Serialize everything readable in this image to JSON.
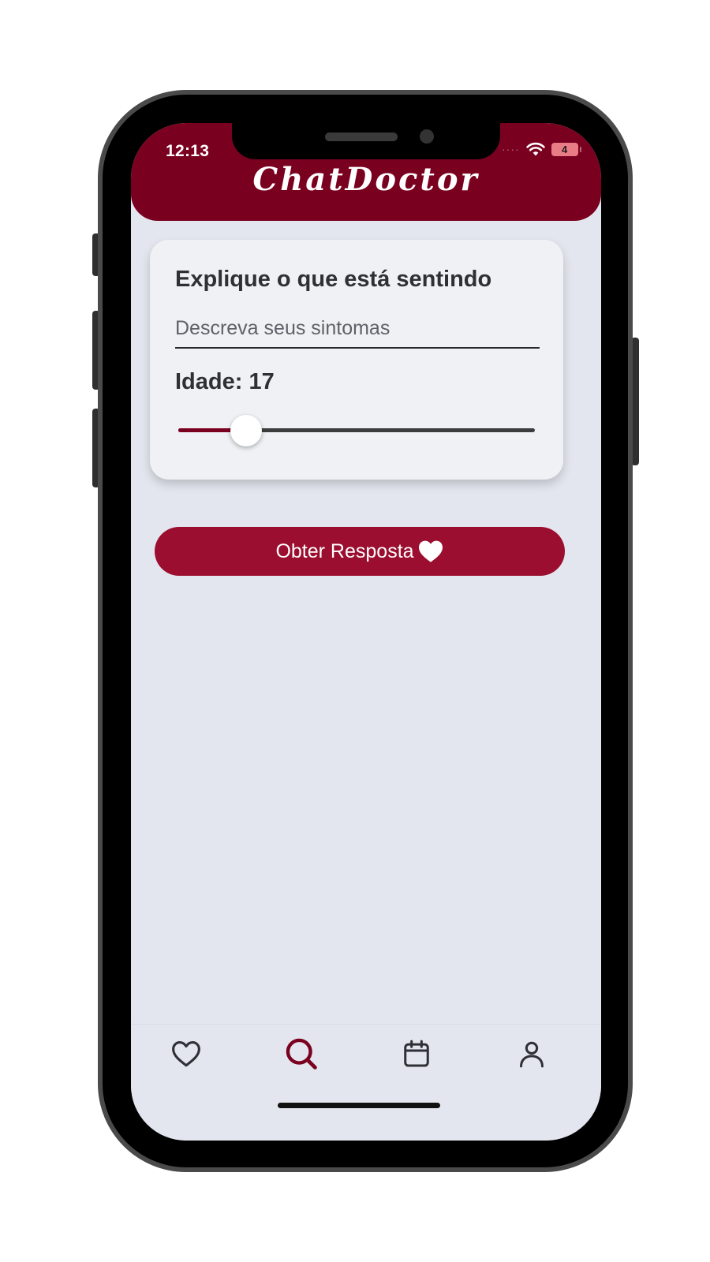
{
  "status_bar": {
    "time": "12:13",
    "signal": "····",
    "battery": "4"
  },
  "header": {
    "title": "ChatDoctor",
    "color": "#7a0020"
  },
  "form": {
    "title": "Explique o que está sentindo",
    "symptoms_placeholder": "Descreva seus sintomas",
    "symptoms_value": "",
    "age_label": "Idade: 17",
    "age_slider_fraction": 0.19
  },
  "submit_button": {
    "label": "Obter Resposta",
    "icon": "heart-icon",
    "color": "#9b0e2f"
  },
  "tab_bar": {
    "active_tab": "search",
    "active_color": "#7a0020",
    "tabs": [
      {
        "id": "favorites",
        "icon": "heart-outline-icon"
      },
      {
        "id": "search",
        "icon": "search-icon"
      },
      {
        "id": "calendar",
        "icon": "calendar-icon"
      },
      {
        "id": "profile",
        "icon": "user-icon"
      }
    ]
  }
}
